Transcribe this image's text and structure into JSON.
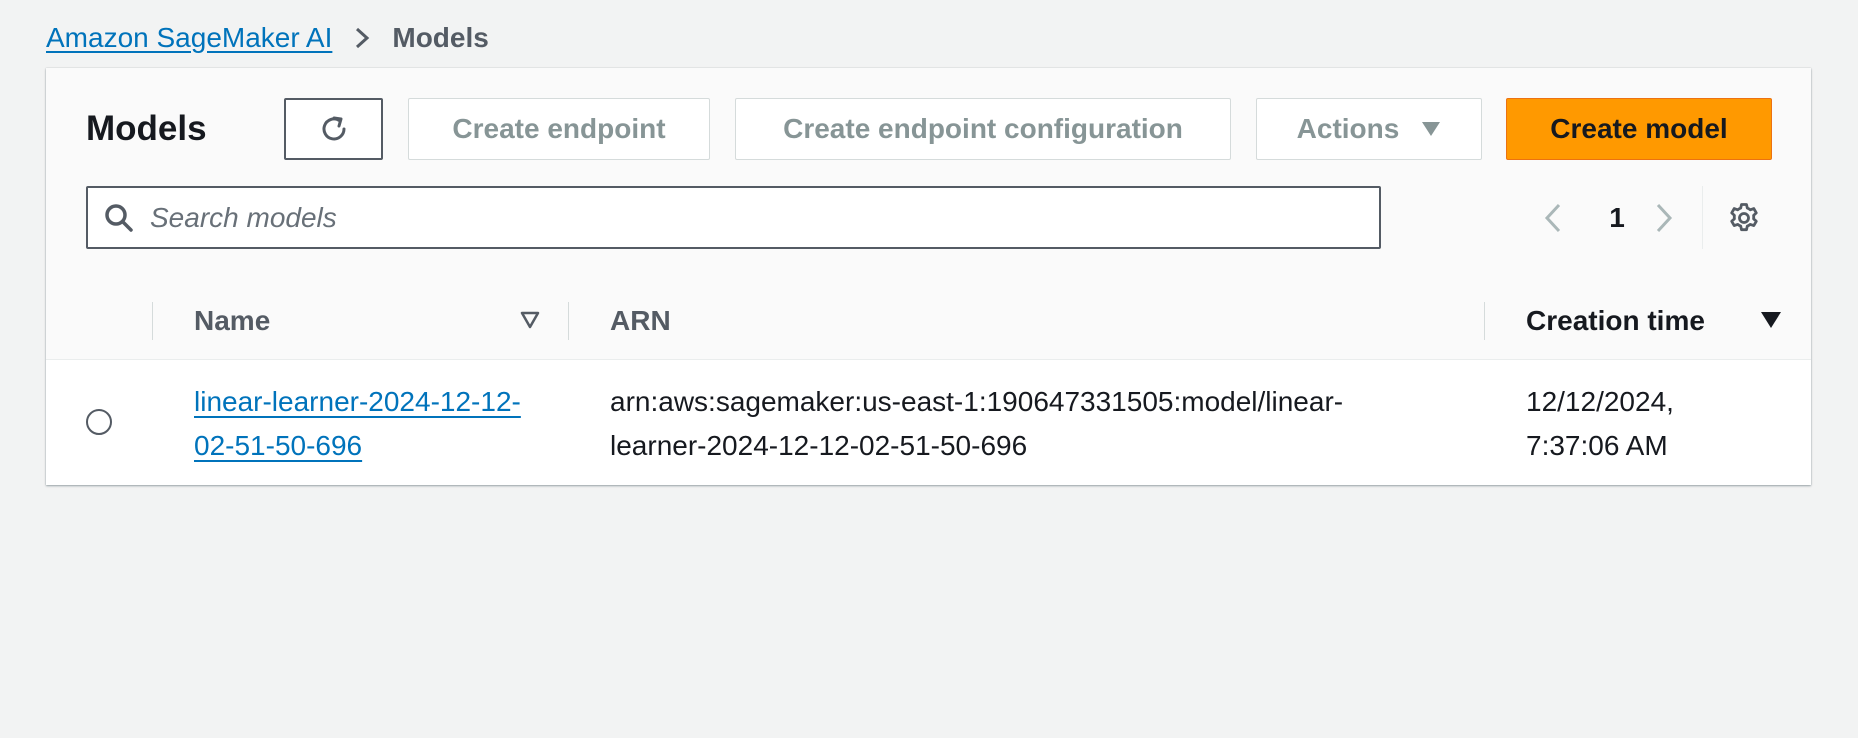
{
  "breadcrumb": {
    "root": "Amazon SageMaker AI",
    "current": "Models"
  },
  "panel": {
    "title": "Models",
    "buttons": {
      "refresh_icon": "refresh-icon",
      "create_endpoint": "Create endpoint",
      "create_endpoint_configuration": "Create endpoint configuration",
      "actions": "Actions",
      "create_model": "Create model"
    },
    "search": {
      "placeholder": "Search models",
      "value": ""
    },
    "pagination": {
      "current_page": "1"
    }
  },
  "table": {
    "columns": {
      "name": "Name",
      "arn": "ARN",
      "creation_time": "Creation time"
    },
    "rows": [
      {
        "name": "linear-learner-2024-12-12-02-51-50-696",
        "arn": "arn:aws:sagemaker:us-east-1:190647331505:model/linear-learner-2024-12-12-02-51-50-696",
        "creation_time": "12/12/2024, 7:37:06 AM"
      }
    ]
  },
  "colors": {
    "background": "#f2f3f3",
    "link": "#0073bb",
    "primary_button": "#ff9900",
    "disabled_text": "#879596"
  }
}
